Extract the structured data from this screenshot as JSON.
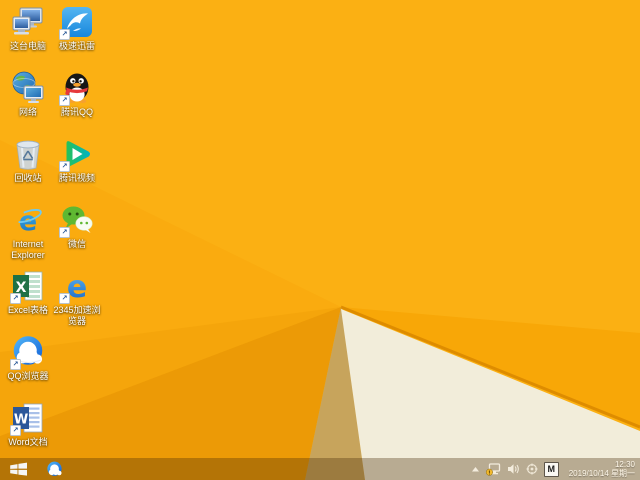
{
  "wallpaper": {
    "base_color": "#FBB013",
    "facet_upper_left": "#FAAB0F",
    "facet_mid_left": "#F5A50B",
    "facet_lower_left": "#EC9A06",
    "facet_khaki": "#C7A45C",
    "facet_cream": "#F2EDDA",
    "facet_right_mid": "#F8A707",
    "edge_line": "#DE8C00"
  },
  "desktop": {
    "column1": [
      {
        "id": "this-pc",
        "label": "这台电脑"
      },
      {
        "id": "network",
        "label": "网络"
      },
      {
        "id": "recycle-bin",
        "label": "回收站"
      },
      {
        "id": "internet-explorer",
        "label": "Internet Explorer"
      },
      {
        "id": "excel",
        "label": "Excel表格"
      },
      {
        "id": "qq-browser",
        "label": "QQ浏览器"
      },
      {
        "id": "word",
        "label": "Word文档"
      }
    ],
    "column2": [
      {
        "id": "thunder-speed",
        "label": "极速迅雷"
      },
      {
        "id": "tencent-qq",
        "label": "腾讯QQ"
      },
      {
        "id": "tencent-video",
        "label": "腾讯视频"
      },
      {
        "id": "wechat",
        "label": "微信"
      },
      {
        "id": "browser-2345",
        "label": "2345加速浏览器"
      }
    ]
  },
  "taskbar": {
    "pinned": [
      "start",
      "qq-browser"
    ],
    "tray_icons": [
      "show-hidden-icons-chevron",
      "network-warning",
      "volume",
      "wheel",
      "ime"
    ],
    "ime_label": "M",
    "clock": {
      "time": "12:30",
      "date": "2019/10/14 星期一"
    }
  }
}
